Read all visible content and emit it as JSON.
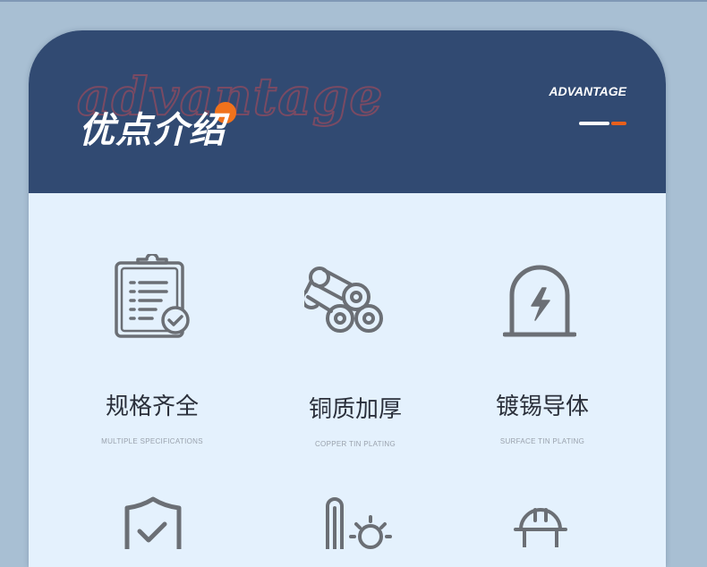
{
  "header": {
    "watermark": "advantage",
    "title": "优点介绍",
    "subtitle": "ADVANTAGE"
  },
  "features": [
    {
      "title": "规格齐全",
      "subtitle": "MULTIPLE SPECIFICATIONS",
      "icon": "clipboard-check-icon"
    },
    {
      "title": "铜质加厚",
      "subtitle": "COPPER TIN PLATING",
      "icon": "copper-rolls-icon"
    },
    {
      "title": "镀锡导体",
      "subtitle": "SURFACE TIN PLATING",
      "icon": "lightning-arch-icon"
    }
  ],
  "second_row_icons": [
    "shield-check-icon",
    "thermometer-sun-icon",
    "hard-hat-icon"
  ],
  "colors": {
    "header_bg": "#314a72",
    "card_bg": "#e4f1fd",
    "accent": "#f0721c",
    "page_bg": "#a8bfd3",
    "icon": "#6b6f75"
  }
}
